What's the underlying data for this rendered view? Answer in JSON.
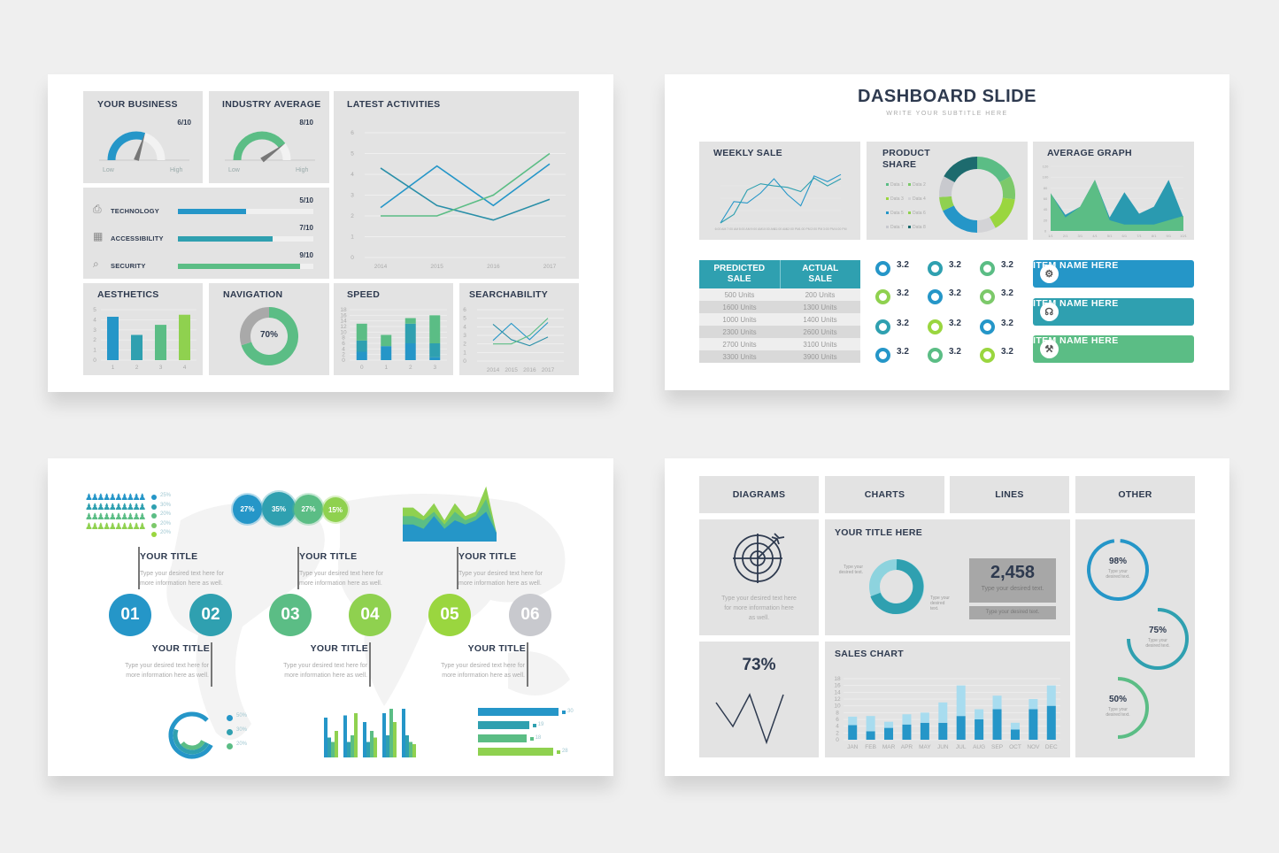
{
  "slide1": {
    "your_business": {
      "title": "YOUR BUSINESS",
      "value_label": "6/10",
      "value": 6,
      "max": 10,
      "low": "Low",
      "high": "High",
      "color": "#2596c8"
    },
    "industry_average": {
      "title": "INDUSTRY AVERAGE",
      "value_label": "8/10",
      "value": 8,
      "max": 10,
      "low": "Low",
      "high": "High",
      "color": "#5bbd85"
    },
    "metrics": [
      {
        "icon": "printer-icon",
        "label": "TECHNOLOGY",
        "value_label": "5/10",
        "value": 0.5,
        "color": "#2596c8"
      },
      {
        "icon": "server-icon",
        "label": "ACCESSIBILITY",
        "value_label": "7/10",
        "value": 0.7,
        "color": "#2fa0b0"
      },
      {
        "icon": "magnifier-icon",
        "label": "SECURITY",
        "value_label": "9/10",
        "value": 0.9,
        "color": "#5bbd85"
      }
    ],
    "latest_activities": {
      "title": "LATEST ACTIVITIES"
    },
    "aesthetics": {
      "title": "AESTHETICS"
    },
    "navigation": {
      "title": "NAVIGATION",
      "value_label": "70%",
      "value": 70
    },
    "speed": {
      "title": "SPEED"
    },
    "searchability": {
      "title": "SEARCHABILITY"
    }
  },
  "slide2": {
    "title": "DASHBOARD SLIDE",
    "subtitle": "WRITE YOUR SUBTITLE HERE",
    "weekly_sale": {
      "title": "WEEKLY SALE"
    },
    "product_share": {
      "title_line1": "PRODUCT",
      "title_line2": "SHARE"
    },
    "average_graph": {
      "title": "AVERAGE GRAPH"
    },
    "table": {
      "headers": [
        [
          "PREDICTED",
          "SALE"
        ],
        [
          "ACTUAL",
          "SALE"
        ]
      ],
      "rows": [
        [
          "500 Units",
          "200 Units"
        ],
        [
          "1600 Units",
          "1300 Units"
        ],
        [
          "1000 Units",
          "1400 Units"
        ],
        [
          "2300 Units",
          "2600 Units"
        ],
        [
          "2700 Units",
          "3100 Units"
        ],
        [
          "3300 Units",
          "3900 Units"
        ]
      ]
    },
    "rings": [
      {
        "value": "3.2",
        "color": "#2596c8"
      },
      {
        "value": "3.2",
        "color": "#2fa0b0"
      },
      {
        "value": "3.2",
        "color": "#5bbd85"
      },
      {
        "value": "3.2",
        "color": "#8fd14f"
      },
      {
        "value": "3.2",
        "color": "#2596c8"
      },
      {
        "value": "3.2",
        "color": "#7cc96a"
      },
      {
        "value": "3.2",
        "color": "#2fa0b0"
      },
      {
        "value": "3.2",
        "color": "#9ad63f"
      },
      {
        "value": "3.2",
        "color": "#2596c8"
      },
      {
        "value": "3.2",
        "color": "#2596c8"
      },
      {
        "value": "3.2",
        "color": "#5bbd85"
      },
      {
        "value": "3.2",
        "color": "#9ad63f"
      }
    ],
    "items": [
      {
        "label": "ITEM NAME HERE",
        "icon": "worker-icon",
        "color": "#2596c8"
      },
      {
        "label": "ITEM NAME HERE",
        "icon": "headset-icon",
        "color": "#2fa0b0"
      },
      {
        "label": "ITEM NAME HERE",
        "icon": "gears-icon",
        "color": "#5bbd85"
      }
    ]
  },
  "slide3": {
    "people_legend": [
      "25%",
      "30%",
      "20%",
      "20%",
      "20%"
    ],
    "bubbles": [
      {
        "label": "27%",
        "color": "#2596c8"
      },
      {
        "label": "35%",
        "color": "#2fa0b0"
      },
      {
        "label": "27%",
        "color": "#5bbd85"
      },
      {
        "label": "15%",
        "color": "#8fd14f"
      }
    ],
    "steps": [
      {
        "num": "01",
        "color": "#2596c8"
      },
      {
        "num": "02",
        "color": "#2fa0b0"
      },
      {
        "num": "03",
        "color": "#5bbd85"
      },
      {
        "num": "04",
        "color": "#8fd14f"
      },
      {
        "num": "05",
        "color": "#9ad63f"
      },
      {
        "num": "06",
        "color": "#c8c9ce"
      }
    ],
    "title": "YOUR TITLE",
    "text_line1": "Type your desired text here for",
    "text_line2": "more information here as well.",
    "radial_legend": [
      "50%",
      "30%",
      "20%"
    ],
    "hbars": [
      {
        "value": 30,
        "label": "30",
        "color": "#2596c8"
      },
      {
        "value": 19,
        "label": "19",
        "color": "#2fa0b0"
      },
      {
        "value": 18,
        "label": "18",
        "color": "#5bbd85"
      },
      {
        "value": 28,
        "label": "28",
        "color": "#8fd14f"
      }
    ]
  },
  "slide4": {
    "tabs": [
      "DIAGRAMS",
      "CHARTS",
      "LINES",
      "OTHER"
    ],
    "diagram_text": [
      "Type your desired text here",
      "for more information here",
      "as well."
    ],
    "your_title": "YOUR TITLE HERE",
    "donut_text_left": [
      "Type your",
      "desired text."
    ],
    "donut_text_right": [
      "Type your",
      "desired",
      "text."
    ],
    "stat": {
      "value": "2,458",
      "caption": "Type your desired text.",
      "sub": "Type your desired text."
    },
    "percent": "73%",
    "sales_chart_title": "SALES CHART",
    "gauges": [
      {
        "label": "98%",
        "value": 98,
        "text": [
          "Type your",
          "desired text."
        ],
        "color": "#2596c8"
      },
      {
        "label": "75%",
        "value": 75,
        "text": [
          "Type your",
          "desired text."
        ],
        "color": "#2fa0b0"
      },
      {
        "label": "50%",
        "value": 50,
        "text": [
          "Type your",
          "desired text."
        ],
        "color": "#5bbd85"
      }
    ]
  },
  "chart_data": [
    {
      "id": "latest_activities",
      "type": "line",
      "title": "LATEST ACTIVITIES",
      "categories": [
        "2014",
        "2015",
        "2016",
        "2017"
      ],
      "ylim": [
        0,
        6
      ],
      "yticks": [
        0,
        1,
        2,
        3,
        4,
        5,
        6
      ],
      "series": [
        {
          "name": "A",
          "color": "#2596c8",
          "values": [
            2.4,
            4.4,
            2.5,
            4.5
          ]
        },
        {
          "name": "B",
          "color": "#2a8fa8",
          "values": [
            4.3,
            2.5,
            1.8,
            2.8
          ]
        },
        {
          "name": "C",
          "color": "#5bbd85",
          "values": [
            2,
            2,
            3,
            5
          ]
        }
      ]
    },
    {
      "id": "aesthetics",
      "type": "bar",
      "title": "AESTHETICS",
      "categories": [
        "1",
        "2",
        "3",
        "4"
      ],
      "values": [
        4.3,
        2.5,
        3.5,
        4.5
      ],
      "colors": [
        "#2596c8",
        "#2fa0b0",
        "#5bbd85",
        "#8fd14f"
      ],
      "ylim": [
        0,
        5
      ],
      "yticks": [
        0,
        1,
        2,
        3,
        4,
        5
      ]
    },
    {
      "id": "navigation",
      "type": "pie",
      "title": "NAVIGATION",
      "values": [
        70,
        30
      ],
      "colors": [
        "#5bbd85",
        "#a9a9a9"
      ]
    },
    {
      "id": "speed",
      "type": "bar",
      "stacked": true,
      "title": "SPEED",
      "categories": [
        "0",
        "1",
        "2",
        "3"
      ],
      "ylim": [
        0,
        18
      ],
      "yticks": [
        0,
        2,
        4,
        6,
        8,
        10,
        12,
        14,
        16,
        18
      ],
      "series": [
        {
          "name": "s1",
          "color": "#2596c8",
          "values": [
            3,
            5,
            6,
            1
          ]
        },
        {
          "name": "s2",
          "color": "#2fa0b0",
          "values": [
            4,
            0,
            7,
            5
          ]
        },
        {
          "name": "s3",
          "color": "#5bbd85",
          "values": [
            6,
            4,
            2,
            10
          ]
        }
      ]
    },
    {
      "id": "searchability",
      "type": "line",
      "title": "SEARCHABILITY",
      "categories": [
        "2014",
        "2015",
        "2016",
        "2017"
      ],
      "ylim": [
        0,
        6
      ],
      "yticks": [
        0,
        1,
        2,
        3,
        4,
        5,
        6
      ],
      "series": [
        {
          "name": "A",
          "color": "#2596c8",
          "values": [
            2.4,
            4.4,
            2.5,
            4.5
          ]
        },
        {
          "name": "B",
          "color": "#2a8fa8",
          "values": [
            4.3,
            2.5,
            1.8,
            2.8
          ]
        },
        {
          "name": "C",
          "color": "#5bbd85",
          "values": [
            2,
            2,
            3,
            5
          ]
        }
      ]
    },
    {
      "id": "weekly_sale",
      "type": "line",
      "title": "WEEKLY SALE",
      "categories": [
        "6:00 AM",
        "7:00 AM",
        "8:00 AM",
        "9:00 AM",
        "10:00 AM",
        "11:00 AM",
        "12:00 PM",
        "1:00 PM",
        "2:00 PM",
        "3:00 PM",
        "4:00 PM"
      ],
      "ylim": [
        0,
        10
      ],
      "series": [
        {
          "name": "A",
          "color": "#2596c8",
          "values": [
            0,
            3,
            2.8,
            4.2,
            6.2,
            4,
            2.4,
            6.6,
            5.8,
            6.8
          ]
        },
        {
          "name": "B",
          "color": "#2fa0b0",
          "values": [
            0,
            1.2,
            4.6,
            5.5,
            5.2,
            5,
            4.4,
            6.3,
            5.2,
            6.2
          ]
        }
      ]
    },
    {
      "id": "product_share",
      "type": "pie",
      "title": "PRODUCT SHARE",
      "labels": [
        "Data 1",
        "Data 2",
        "Data 3",
        "Data 4",
        "Data 5",
        "Data 6",
        "Data 7",
        "Data 8"
      ],
      "values": [
        17,
        10,
        15,
        8,
        18,
        6,
        9,
        17
      ],
      "colors": [
        "#5bbd85",
        "#7cc96a",
        "#9ad63f",
        "#d3d3d6",
        "#2596c8",
        "#8fd14f",
        "#c8c9ce",
        "#1d6b6e"
      ]
    },
    {
      "id": "average_graph",
      "type": "area",
      "title": "AVERAGE GRAPH",
      "categories": [
        "1/1",
        "2/1",
        "3/1",
        "4/1",
        "5/1",
        "6/1",
        "7/1",
        "8/1",
        "9/1",
        "10/1"
      ],
      "ylim": [
        0,
        120
      ],
      "yticks": [
        0,
        20,
        40,
        60,
        80,
        100,
        120
      ],
      "series": [
        {
          "name": "A",
          "color": "#2a9ab0",
          "values": [
            70,
            30,
            45,
            95,
            25,
            72,
            32,
            45,
            95,
            25
          ]
        },
        {
          "name": "B",
          "color": "#5bbd85",
          "values": [
            70,
            25,
            45,
            95,
            20,
            12,
            12,
            12,
            20,
            28
          ]
        }
      ]
    },
    {
      "id": "sales_chart",
      "type": "bar",
      "stacked": true,
      "title": "SALES CHART",
      "categories": [
        "JAN",
        "FEB",
        "MAR",
        "APR",
        "MAY",
        "JUN",
        "JUL",
        "AUG",
        "SEP",
        "OCT",
        "NOV",
        "DEC"
      ],
      "ylim": [
        0,
        18
      ],
      "yticks": [
        0,
        2,
        4,
        6,
        8,
        10,
        12,
        14,
        16,
        18
      ],
      "series": [
        {
          "name": "base",
          "color": "#2596c8",
          "values": [
            4.3,
            2.5,
            3.5,
            4.5,
            5,
            5,
            7,
            6,
            9,
            3,
            9,
            10
          ]
        },
        {
          "name": "top",
          "color": "#a8dcef",
          "values": [
            2.5,
            4.5,
            1.8,
            3,
            3,
            6,
            9,
            3,
            4,
            2,
            3,
            6
          ]
        }
      ]
    },
    {
      "id": "radial",
      "type": "pie",
      "values": [
        50,
        30,
        20
      ],
      "colors": [
        "#2596c8",
        "#2fa0b0",
        "#5bbd85"
      ]
    },
    {
      "id": "grouped",
      "type": "bar",
      "series": [
        {
          "color": "#2596c8",
          "values": [
            9,
            9.5,
            8,
            10,
            11
          ]
        },
        {
          "color": "#2fa0b0",
          "values": [
            4.5,
            3.5,
            3.5,
            5,
            5
          ]
        },
        {
          "color": "#5bbd85",
          "values": [
            3.5,
            5,
            6,
            11,
            3.5
          ]
        },
        {
          "color": "#8fd14f",
          "values": [
            6,
            10,
            4.5,
            8,
            3
          ]
        }
      ]
    },
    {
      "id": "mountain",
      "type": "area",
      "series": [
        {
          "color": "#8fd14f",
          "values": [
            6,
            6,
            4,
            7,
            3,
            7,
            4,
            5,
            11,
            0
          ]
        },
        {
          "color": "#5bbd85",
          "values": [
            4,
            4,
            3,
            5,
            2,
            5,
            3,
            4,
            8,
            0
          ]
        },
        {
          "color": "#2596c8",
          "values": [
            2,
            2,
            1,
            4,
            1,
            3,
            2,
            3,
            5,
            0
          ]
        }
      ]
    },
    {
      "id": "line73",
      "type": "line",
      "values": [
        5,
        2,
        6,
        0,
        6
      ]
    }
  ]
}
